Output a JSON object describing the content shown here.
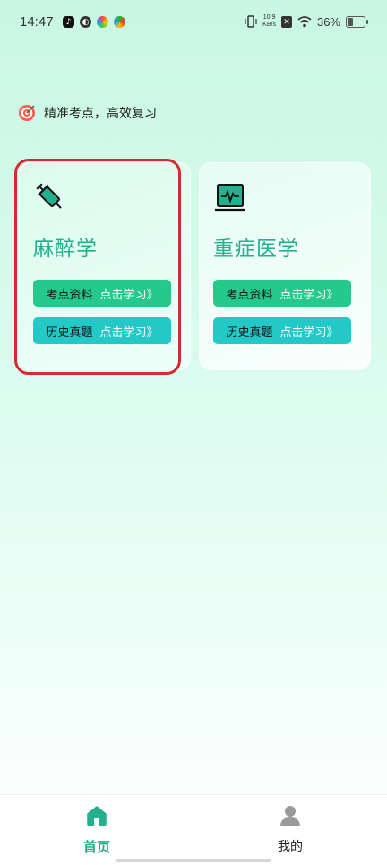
{
  "status_bar": {
    "time": "14:47",
    "speed_value": "10.9",
    "speed_unit": "KB/s",
    "battery": "36%"
  },
  "slogan": {
    "text": "精准考点，高效复习",
    "icon": "target-icon"
  },
  "cards": [
    {
      "title": "麻醉学",
      "icon": "syringe-icon",
      "selected": true,
      "buttons": [
        {
          "label": "考点资料",
          "action": "点击学习》",
          "color": "#24c98b"
        },
        {
          "label": "历史真题",
          "action": "点击学习》",
          "color": "#22c9c6"
        }
      ]
    },
    {
      "title": "重症医学",
      "icon": "monitor-icon",
      "selected": false,
      "buttons": [
        {
          "label": "考点资料",
          "action": "点击学习》",
          "color": "#24c98b"
        },
        {
          "label": "历史真题",
          "action": "点击学习》",
          "color": "#22c9c6"
        }
      ]
    }
  ],
  "tabbar": {
    "items": [
      {
        "label": "首页",
        "icon": "home-icon",
        "active": true
      },
      {
        "label": "我的",
        "icon": "user-icon",
        "active": false
      }
    ]
  },
  "colors": {
    "accent": "#22b08f",
    "highlight": "#d42a33"
  }
}
